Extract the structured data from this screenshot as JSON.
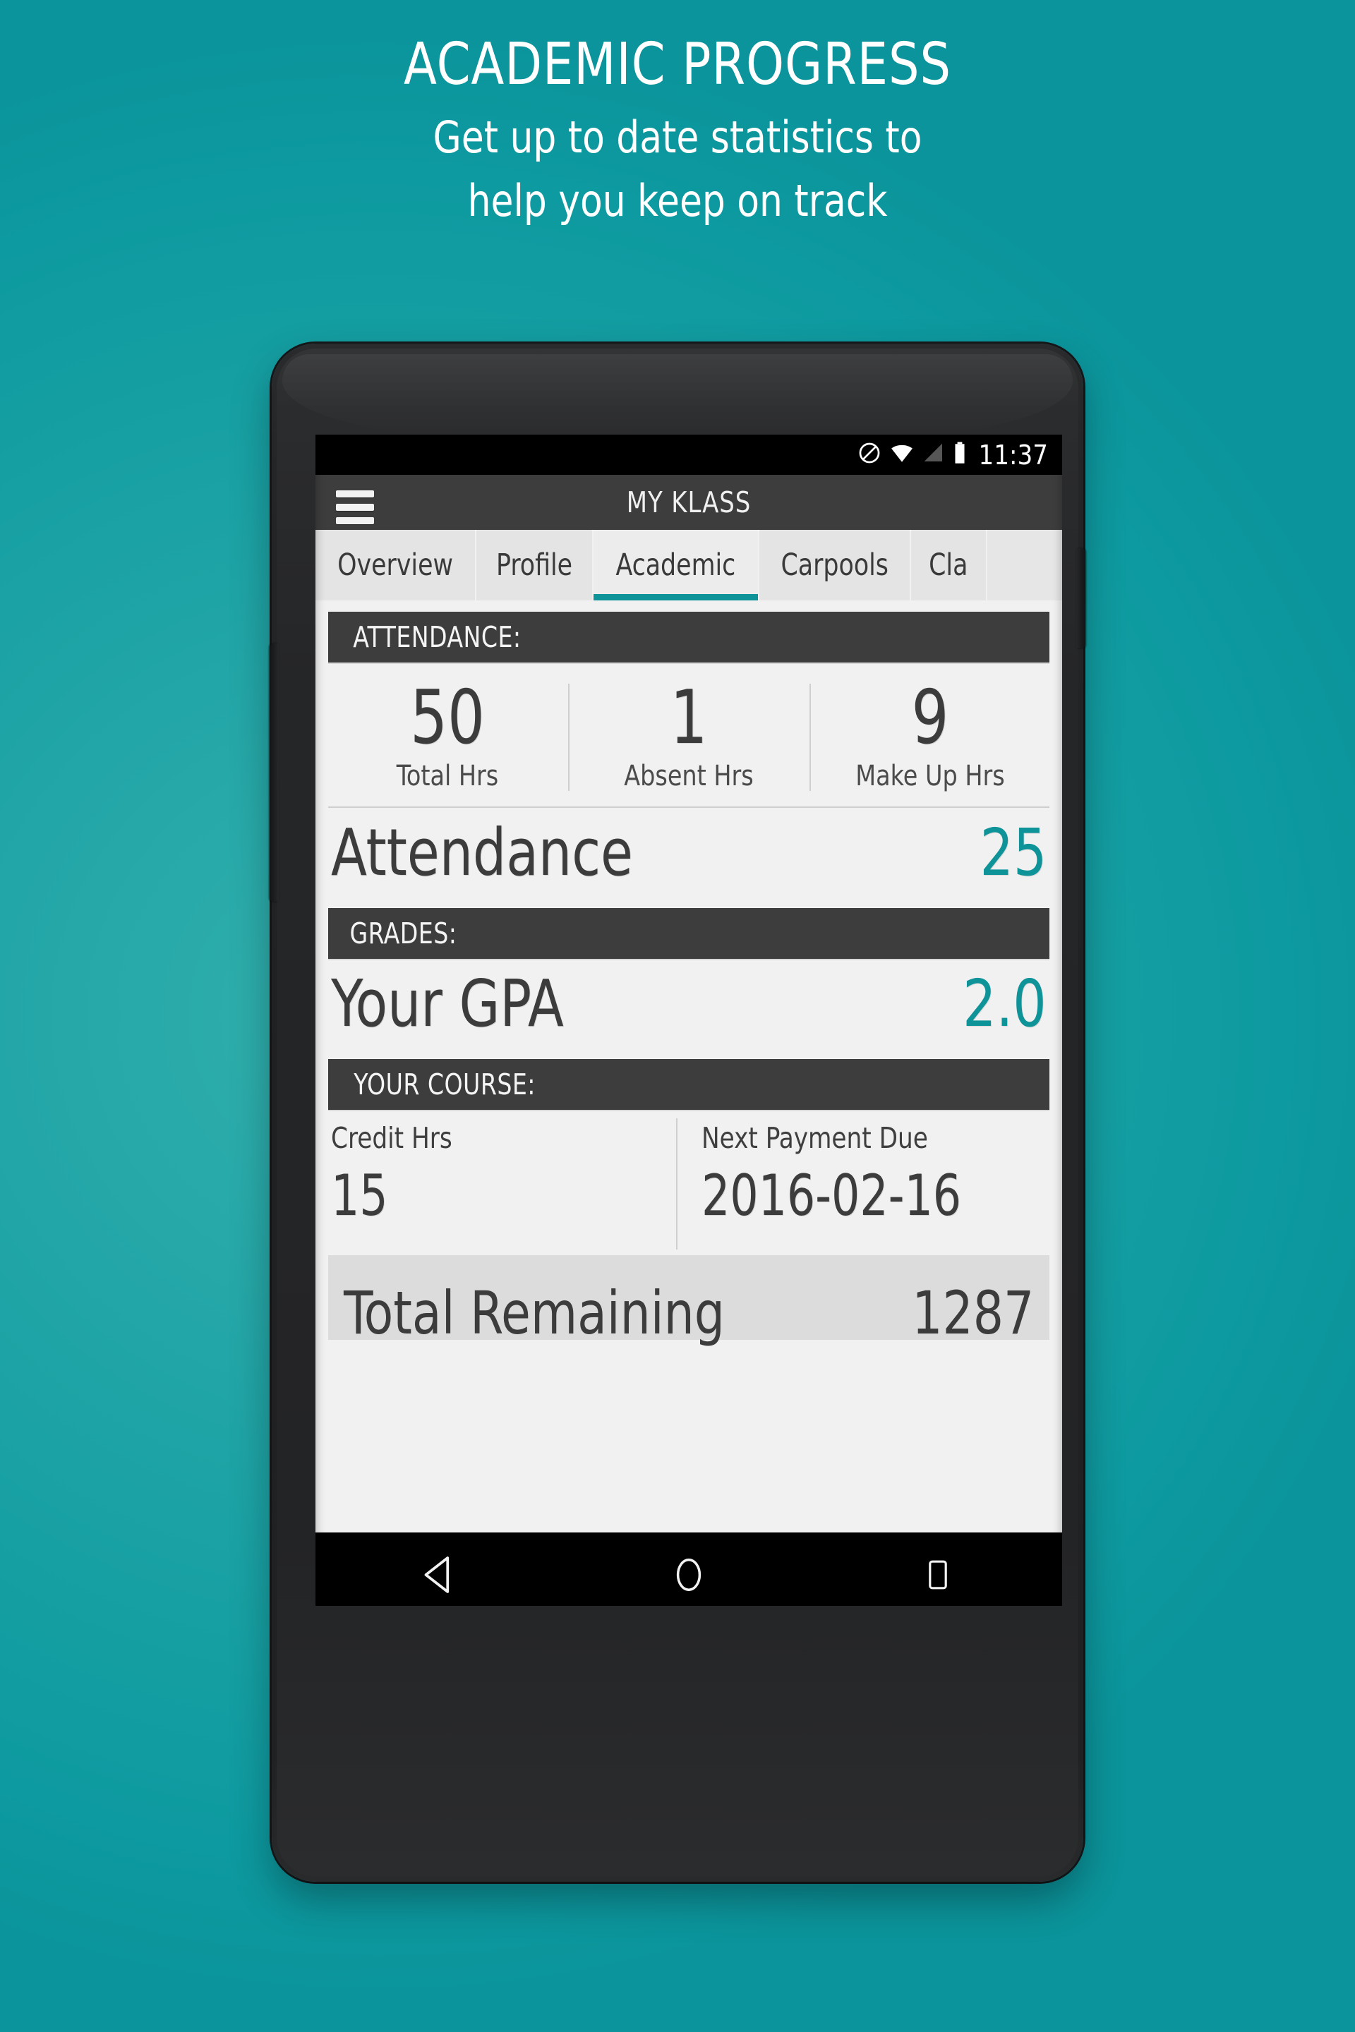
{
  "promo": {
    "title": "ACADEMIC PROGRESS",
    "subtitle_line1": "Get up to date statistics to",
    "subtitle_line2": "help you keep on track",
    "background_color": "#17a0a3",
    "text_color": "#ffffff"
  },
  "statusbar": {
    "time": "11:37",
    "icons": [
      "do-not-disturb-icon",
      "wifi-icon",
      "cellular-signal-icon",
      "battery-icon"
    ]
  },
  "appbar": {
    "title": "MY KLASS",
    "menu_icon": "hamburger-menu-icon",
    "background_color": "#3d3d3d"
  },
  "tabs": {
    "selected_index": 2,
    "accent_color": "#0d9398",
    "items": [
      {
        "label": "Overview"
      },
      {
        "label": "Profile"
      },
      {
        "label": "Academic"
      },
      {
        "label": "Carpools"
      },
      {
        "label": "Cla"
      }
    ]
  },
  "sections": {
    "attendance": {
      "header": "ATTENDANCE:",
      "stats": [
        {
          "value": "50",
          "label": "Total Hrs"
        },
        {
          "value": "1",
          "label": "Absent Hrs"
        },
        {
          "value": "9",
          "label": "Make Up Hrs"
        }
      ],
      "summary": {
        "label": "Attendance",
        "value": "25"
      }
    },
    "grades": {
      "header": "GRADES:",
      "summary": {
        "label": "Your GPA",
        "value": "2.0"
      }
    },
    "course": {
      "header": "YOUR COURSE:",
      "cells": [
        {
          "label": "Credit Hrs",
          "value": "15"
        },
        {
          "label": "Next Payment Due",
          "value": "2016-02-16"
        }
      ],
      "remaining": {
        "label": "Total Remaining",
        "value": "1287"
      }
    }
  },
  "navbar": {
    "back_icon": "back-triangle-icon",
    "home_icon": "home-circle-icon",
    "recents_icon": "recents-square-icon"
  }
}
